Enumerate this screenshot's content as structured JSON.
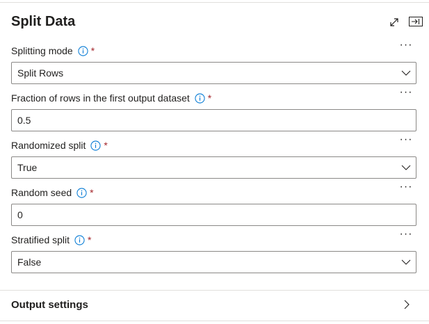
{
  "panel": {
    "title": "Split Data",
    "icons": {
      "expand": "expand-diagonal-icon",
      "dock": "dock-panel-icon"
    }
  },
  "fields": {
    "splitting_mode": {
      "label": "Splitting mode",
      "required": "*",
      "value": "Split Rows",
      "type": "dropdown"
    },
    "fraction": {
      "label": "Fraction of rows in the first output dataset",
      "required": "*",
      "value": "0.5",
      "type": "text"
    },
    "randomized_split": {
      "label": "Randomized split",
      "required": "*",
      "value": "True",
      "type": "dropdown"
    },
    "random_seed": {
      "label": "Random seed",
      "required": "*",
      "value": "0",
      "type": "text"
    },
    "stratified_split": {
      "label": "Stratified split",
      "required": "*",
      "value": "False",
      "type": "dropdown"
    }
  },
  "more_label": "···",
  "output_settings": {
    "label": "Output settings"
  },
  "colors": {
    "required": "#a4262c",
    "info_icon": "#0078d4",
    "border": "#8a8886",
    "divider": "#e1dfdd"
  }
}
